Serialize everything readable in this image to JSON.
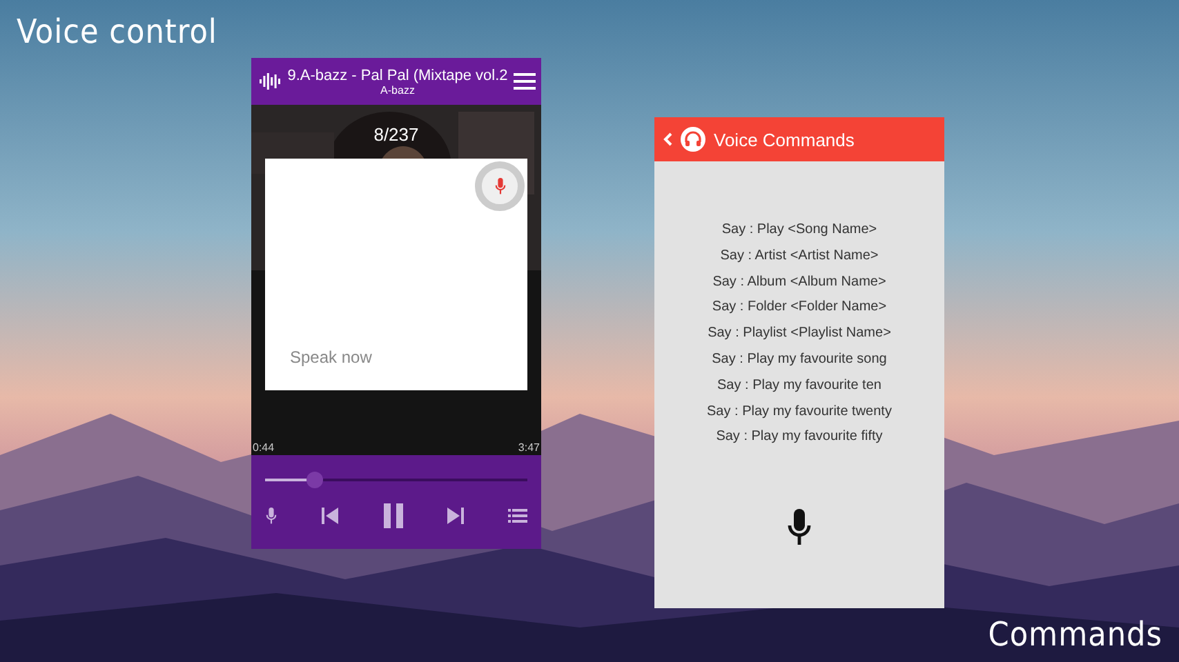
{
  "captions": [
    "Voice control",
    "Commands"
  ],
  "player": {
    "title": "9.A-bazz - Pal Pal (Mixtape vol.2",
    "artist": "A-bazz",
    "counter": "8/237",
    "elapsed": "0:44",
    "duration": "3:47",
    "level": 0.19,
    "voice_dialog": {
      "prompt": "Speak now"
    }
  },
  "commands": {
    "title": "Voice Commands",
    "lines": [
      "Say : Play <Song Name>",
      "Say : Artist <Artist Name>",
      "Say : Album <Album Name>",
      "Say : Folder <Folder Name>",
      "Say : Playlist <Playlist Name>",
      "Say : Play my favourite song",
      "Say : Play my favourite ten",
      "Say : Play my favourite twenty",
      "Say : Play my favourite fifty"
    ]
  }
}
